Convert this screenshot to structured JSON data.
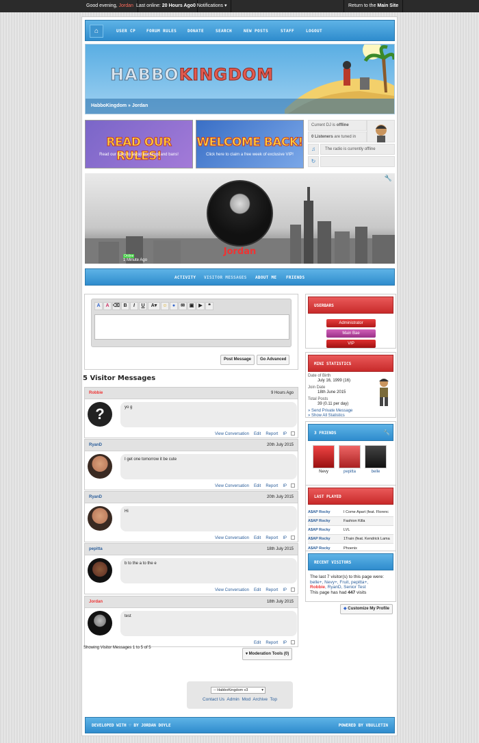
{
  "topbar": {
    "greeting": "Good evening,",
    "user": "Jordan",
    "last_online_label": "Last online:",
    "last_online": "20 Hours Ago",
    "notif_count": "0",
    "notif_label": "Notifications",
    "return_prefix": "Return to the",
    "return_site": "Main Site"
  },
  "nav": {
    "items": [
      "USER CP",
      "FORUM RULES",
      "DONATE",
      "SEARCH",
      "NEW POSTS",
      "STAFF",
      "LOGOUT"
    ]
  },
  "banner": {
    "logo_a": "HABBO",
    "logo_b": "KINGDOM",
    "crumb": "HabboKingdom » Jordan"
  },
  "promos": [
    {
      "title": "READ OUR RULES!",
      "sub": "Read our rules to avoid warnings and bans!"
    },
    {
      "title": "WELCOME BACK!",
      "sub": "Click here to claim a free week of exclusive VIP!"
    }
  ],
  "radio": {
    "dj_label": "Current DJ is",
    "dj_status": "offline",
    "listeners": "0 Listeners",
    "listeners_suffix": "are tuned in",
    "offline_msg": "The radio is currently offline"
  },
  "profile": {
    "name": "Jordan",
    "status_word": "Online",
    "last": "1 Minute Ago"
  },
  "tabs": [
    "ACTIVITY",
    "VISITOR MESSAGES",
    "ABOUT ME",
    "FRIENDS"
  ],
  "editor": {
    "post_label": "Post Message",
    "advanced_label": "Go Advanced"
  },
  "vm_header": "5 Visitor Messages",
  "messages": [
    {
      "user": "Robbie",
      "date": "9 Hours Ago",
      "text": "yo g"
    },
    {
      "user": "RyanD",
      "date": "20th July 2015",
      "text": "I get one tomorrow it be cute"
    },
    {
      "user": "RyanD",
      "date": "20th July 2015",
      "text": "Hi"
    },
    {
      "user": "pepitta",
      "date": "18th July 2015",
      "text": "b to the a to the e"
    },
    {
      "user": "Jordan",
      "date": "18th July 2015",
      "text": "test"
    }
  ],
  "msg_actions": {
    "view": "View Conversation",
    "edit": "Edit",
    "report": "Report",
    "ip": "IP"
  },
  "showing": "Showing Visitor Messages 1 to 5 of 5",
  "mod_tools": "▾ Moderation Tools (0)",
  "usergroups": {
    "title": "USERBARS",
    "bars": [
      "Administrator",
      "Main Bae",
      "VIP"
    ]
  },
  "stats": {
    "title": "MINI STATISTICS",
    "dob_label": "Date of Birth",
    "dob": "July 16, 1999 (16)",
    "join_label": "Join Date",
    "join": "18th June 2015",
    "posts_label": "Total Posts",
    "posts": "39 (0.11 per day)",
    "pm_link": "» Send Private Message",
    "stats_link": "» Show All Statistics"
  },
  "friends": {
    "title": "3 FRIENDS",
    "names": [
      "Nevy",
      "pepitta",
      "belle"
    ]
  },
  "last_played": {
    "title": "LAST PLAYED",
    "rows": [
      [
        "A$AP Rocky",
        "I Come Apart (feat. Florenc"
      ],
      [
        "A$AP Rocky",
        "Fashion Killa"
      ],
      [
        "A$AP Rocky",
        "LVL"
      ],
      [
        "A$AP Rocky",
        "1Train (feat. Kendrick Lama"
      ],
      [
        "A$AP Rocky",
        "Phoenix"
      ]
    ]
  },
  "visitors": {
    "title": "RECENT VISITORS",
    "intro": "The last 7 visitor(s) to this page were:",
    "list_a": "belle+, Nevy+, Fruit, pepitta+,",
    "robbie": "Robbie",
    "list_b": ", RyanD, Senior Test",
    "visits_pre": "This page has had",
    "visits": "447",
    "visits_post": "visits"
  },
  "customize": "Customize My Profile",
  "footer": {
    "style": "-- HabboKingdom v3",
    "links": [
      "Contact Us",
      "Admin",
      "Mod",
      "Archive",
      "Top"
    ]
  },
  "bottombar": {
    "left": "DEVELOPED WITH ♡ BY JORDAN DOYLE",
    "right": "POWERED BY VBULLETIN"
  }
}
